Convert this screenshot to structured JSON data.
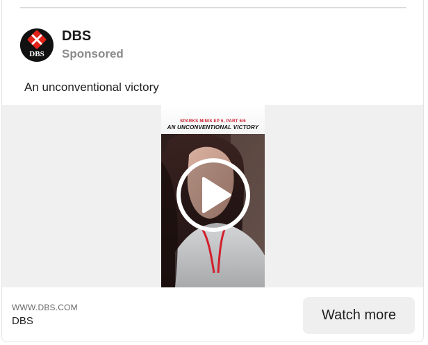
{
  "ad": {
    "advertiser_name": "DBS",
    "sponsored_label": "Sponsored",
    "caption": "An unconventional victory",
    "logo_text": "DBS",
    "video": {
      "subtitle": "SPARKS MINIS EP 6, PART 6/6",
      "title": "AN UNCONVENTIONAL VICTORY",
      "play_icon": "play-icon"
    },
    "footer": {
      "domain": "WWW.DBS.COM",
      "name": "DBS",
      "cta_label": "Watch more"
    }
  },
  "colors": {
    "brand_red": "#e2231a",
    "cta_bg": "#efefef",
    "muted_text": "#8a8a8a"
  }
}
